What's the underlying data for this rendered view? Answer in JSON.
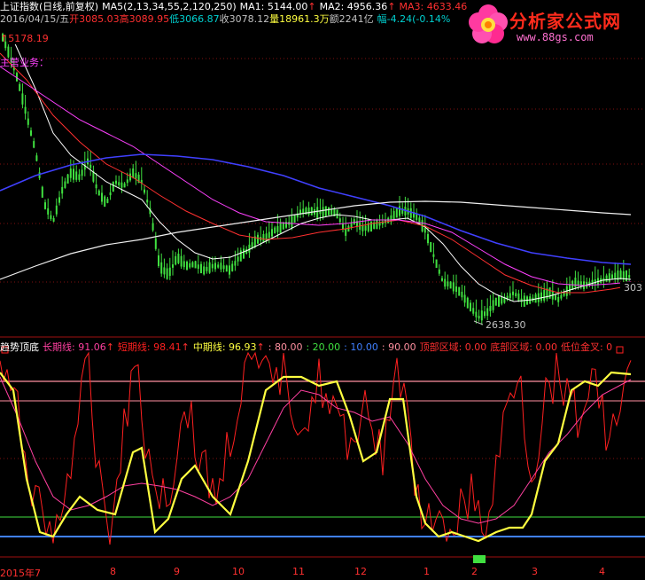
{
  "header": {
    "title": "上证指数(日线,前复权)",
    "ma_formula": "MA5(2,13,34,55,2,120,250)",
    "ma1": "MA1: 5144.00",
    "ma2": "MA2: 4956.36",
    "ma3": "MA3: 4633.46",
    "date": "2016/04/15/五",
    "open": "开3085.03",
    "high": "高3089.95",
    "low": "低3066.87",
    "close": "收3078.12",
    "volume": "量18961.3万",
    "amount": "额2241亿",
    "change": "幅-4.24(-0.14%",
    "arrow": "↑"
  },
  "price_labels": {
    "high_marker": "5178.19",
    "low_marker": "2638.30",
    "right_value": "303",
    "main_business": "主营业务："
  },
  "indicator": {
    "name": "趋势顶底",
    "long_line": "长期线: 91.06",
    "short_line": "短期线: 98.41",
    "mid_line": "中期线: 96.93",
    "v80": ": 80.00",
    "v20": ": 20.00",
    "v10": ": 10.00",
    "v90": ": 90.00",
    "top_zone": "顶部区域: 0.00",
    "bottom_zone": "底部区域: 0.00",
    "low_golden": "低位金叉: 0"
  },
  "x_axis": {
    "labels": [
      "2015年7",
      "8",
      "9",
      "10",
      "11",
      "12",
      "1",
      "2",
      "3",
      "4"
    ]
  },
  "logo": {
    "text": "分析家公式网",
    "url": "www.88gs.com"
  },
  "colors": {
    "background": "#000000",
    "up": "#ff3030",
    "down": "#00ffff",
    "ma1": "#ffffff",
    "ma2": "#ff3030",
    "ma3": "#ff40ff",
    "ma_long": "#4040ff",
    "ma_white": "#f0f0f0",
    "candle": "#40e040",
    "short_line": "#ff2020",
    "mid_line": "#ffff40",
    "long_line": "#ff40a0",
    "level80": "#ff90a0",
    "level20": "#40e040",
    "level10": "#4080ff"
  }
}
